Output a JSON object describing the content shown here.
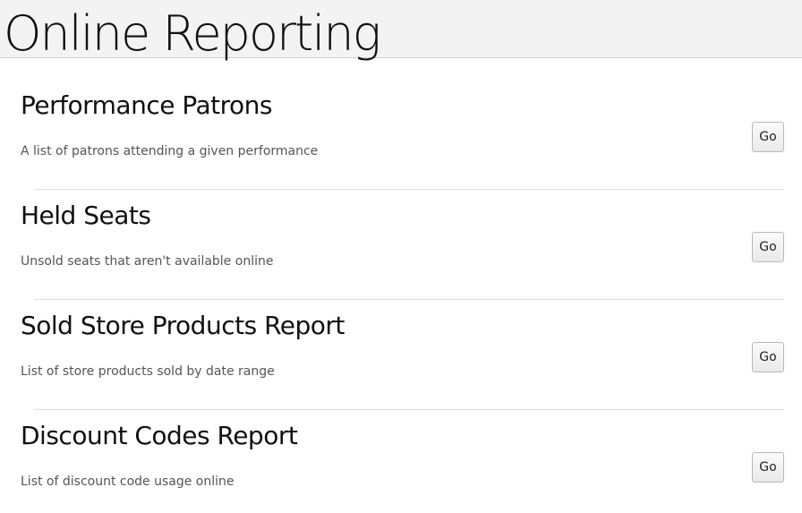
{
  "page": {
    "title": "Online Reporting"
  },
  "reports": [
    {
      "title": "Performance Patrons",
      "description": "A list of patrons attending a given performance",
      "button_label": "Go"
    },
    {
      "title": "Held Seats",
      "description": "Unsold seats that aren't available online",
      "button_label": "Go"
    },
    {
      "title": "Sold Store Products Report",
      "description": "List of store products sold by date range",
      "button_label": "Go"
    },
    {
      "title": "Discount Codes Report",
      "description": "List of discount code usage online",
      "button_label": "Go"
    }
  ]
}
